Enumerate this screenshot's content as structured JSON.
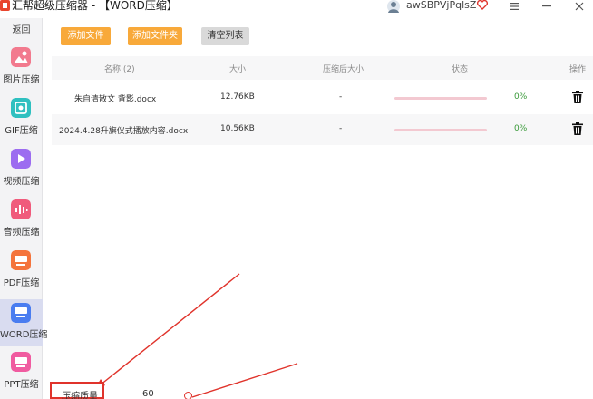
{
  "app": {
    "title": "汇帮超级压缩器  - 【WORD压缩】",
    "username": "awSBPVjPqlsZ",
    "accent_color": "#f8a93a",
    "annotation_color": "#e0332b"
  },
  "sidebar": {
    "back_label": "返回",
    "items": [
      {
        "label": "图片压缩",
        "icon": "image-icon",
        "color": "#f27a8e"
      },
      {
        "label": "GIF压缩",
        "icon": "gif-icon",
        "color": "#2fc0c0"
      },
      {
        "label": "视频压缩",
        "icon": "video-play-icon",
        "color": "#9c6cf0"
      },
      {
        "label": "音频压缩",
        "icon": "audio-icon",
        "color": "#f05b7c"
      },
      {
        "label": "PDF压缩",
        "icon": "pdf-icon",
        "color": "#f4743c"
      },
      {
        "label": "WORD压缩",
        "icon": "word-icon",
        "color": "#4a7df0",
        "active": true
      },
      {
        "label": "PPT压缩",
        "icon": "ppt-icon",
        "color": "#f05ba0"
      }
    ]
  },
  "toolbar": {
    "add_file_label": "添加文件",
    "add_folder_label": "添加文件夹",
    "clear_list_label": "清空列表"
  },
  "table": {
    "columns": [
      "名称 (2)",
      "大小",
      "压缩后大小",
      "状态",
      "操作"
    ],
    "rows": [
      {
        "name": "朱自清散文    背影.docx",
        "size": "12.76KB",
        "compressed": "-",
        "progress": 0,
        "percent": "0%"
      },
      {
        "name": "2024.4.28升旗仪式播放内容.docx",
        "size": "10.56KB",
        "compressed": "-",
        "progress": 0,
        "percent": "0%"
      }
    ]
  },
  "bottom": {
    "label": "压缩质量",
    "value": "60"
  }
}
